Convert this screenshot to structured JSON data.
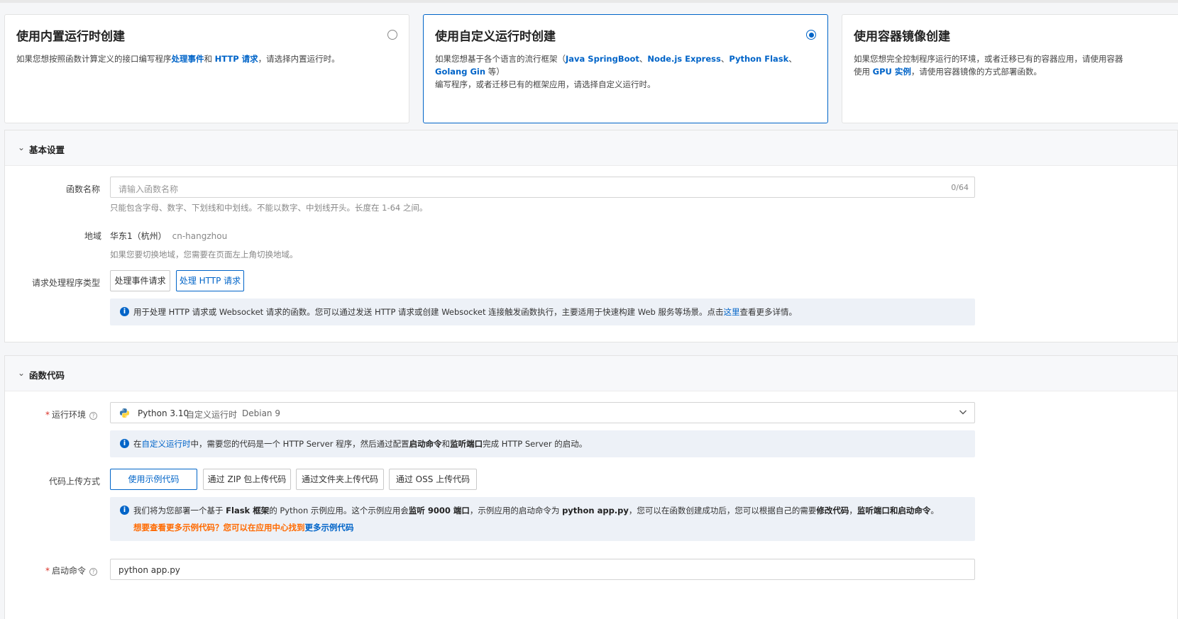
{
  "cards": [
    {
      "title": "使用内置运行时创建",
      "desc_prefix": "如果您想按照函数计算定义的接口编写程序",
      "link1": "处理事件",
      "mid": "和 ",
      "link2": "HTTP 请求",
      "desc_suffix": "，请选择内置运行时。",
      "selected": false
    },
    {
      "title": "使用自定义运行时创建",
      "desc_prefix": "如果您想基于各个语言的流行框架（",
      "f1": "Java SpringBoot",
      "sep1": "、",
      "f2": "Node.js Express",
      "sep2": "、",
      "f3": "Python Flask",
      "sep3": "、",
      "f4": "Golang Gin",
      "desc_mid": " 等）",
      "desc_line2": "编写程序，或者迁移已有的框架应用，请选择自定义运行时。",
      "selected": true
    },
    {
      "title": "使用容器镜像创建",
      "desc_line1": "如果您想完全控制程序运行的环境，或者迁移已有的容器应用，请使用容器",
      "desc_line2_prefix": "使用 ",
      "link": "GPU 实例",
      "desc_line2_suffix": "，请使用容器镜像的方式部署函数。",
      "selected": false
    }
  ],
  "basic": {
    "title": "基本设置",
    "name_label": "函数名称",
    "name_placeholder": "请输入函数名称",
    "name_count": "0/64",
    "name_hint": "只能包含字母、数字、下划线和中划线。不能以数字、中划线开头。长度在 1-64 之间。",
    "region_label": "地域",
    "region_value": "华东1（杭州）",
    "region_code": "cn-hangzhou",
    "region_hint": "如果您要切换地域，您需要在页面左上角切换地域。",
    "handler_label": "请求处理程序类型",
    "handler_options": [
      "处理事件请求",
      "处理 HTTP 请求"
    ],
    "handler_selected": "处理 HTTP 请求",
    "notice_prefix": "用于处理 HTTP 请求或 Websocket 请求的函数。您可以通过发送 HTTP 请求或创建 Websocket 连接触发函数执行，主要适用于快速构建 Web 服务等场景。点击",
    "notice_link": "这里",
    "notice_suffix": "查看更多详情。"
  },
  "code": {
    "title": "函数代码",
    "runtime_label": "运行环境",
    "runtime_required": "*",
    "runtime_value": "Python 3.10",
    "runtime_type": "自定义运行时",
    "runtime_os": "Debian 9",
    "runtime_notice_prefix": "在",
    "runtime_notice_link": "自定义运行时",
    "runtime_notice_mid1": "中，需要您的代码是一个 HTTP Server 程序，然后通过配置",
    "runtime_notice_b1": "启动命令",
    "runtime_notice_and": "和",
    "runtime_notice_b2": "监听端口",
    "runtime_notice_suffix": "完成 HTTP Server 的启动。",
    "upload_label": "代码上传方式",
    "upload_options": [
      "使用示例代码",
      "通过 ZIP 包上传代码",
      "通过文件夹上传代码",
      "通过 OSS 上传代码"
    ],
    "upload_selected": "使用示例代码",
    "sample_p1": "我们将为您部署一个基于 ",
    "sample_b1": "Flask 框架",
    "sample_p2": "的 Python 示例应用。这个示例应用会",
    "sample_b2": "监听 9000 端口",
    "sample_p3": "，示例应用的启动命令为 ",
    "sample_b3": "python app.py",
    "sample_p4": "，您可以在函数创建成功后，您可以根据自己的需要",
    "sample_b4": "修改代码",
    "sample_p5": "，",
    "sample_b5": "监听端口和启动命令",
    "sample_p6": "。",
    "sample_more_orange": "想要查看更多示例代码？您可以在应用中心找到",
    "sample_more_link": "更多示例代码",
    "start_label": "启动命令",
    "start_required": "*",
    "start_value": "python app.py"
  },
  "colors": {
    "primary": "#0064c8",
    "orange": "#ff6a00",
    "notice_bg": "#edf1f7"
  }
}
